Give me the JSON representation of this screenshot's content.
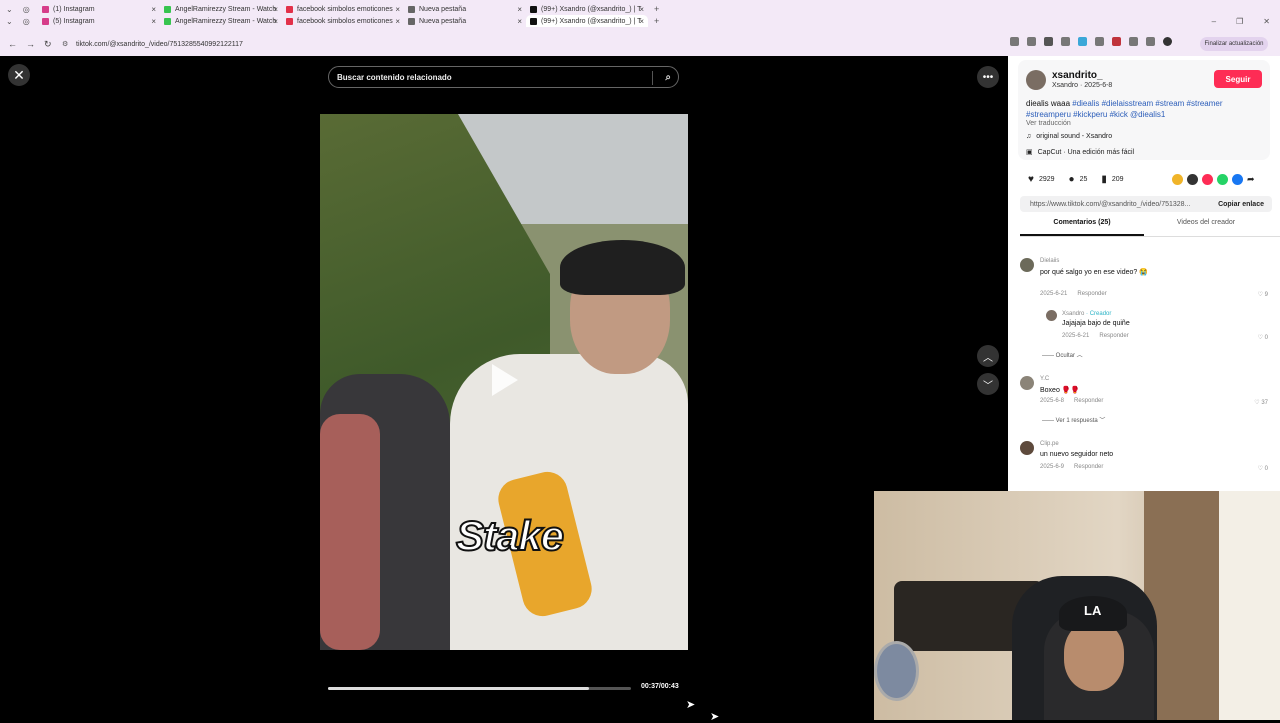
{
  "browser": {
    "tabs_row1": [
      {
        "label": "(1) Instagram",
        "color": "#d63c8a"
      },
      {
        "label": "AngelRamirezzy Stream - Watch",
        "color": "#37c44f"
      },
      {
        "label": "facebook simbolos emoticones",
        "color": "#e2314a"
      },
      {
        "label": "Nueva pestaña",
        "color": "#666666"
      },
      {
        "label": "(99+) Xsandro (@xsandrito_) | T",
        "color": "#111111"
      }
    ],
    "tabs_row2": [
      {
        "label": "(5) Instagram",
        "color": "#d63c8a"
      },
      {
        "label": "AngelRamirezzy Stream - Watch",
        "color": "#37c44f"
      },
      {
        "label": "facebook simbolos emoticones",
        "color": "#e2314a"
      },
      {
        "label": "Nueva pestaña",
        "color": "#666666"
      },
      {
        "label": "(99+) Xsandro (@xsandrito_) | T",
        "color": "#111111"
      }
    ],
    "url": "tiktok.com/@xsandrito_/video/7513285540992122117",
    "update_button": "Finalizar actualización"
  },
  "player": {
    "search_placeholder": "Buscar contenido relacionado",
    "overlay_text": "Stake",
    "time": "00:37/00:43",
    "progress_fraction": 0.86
  },
  "post": {
    "username": "xsandrito_",
    "subtitle": "Xsandro · 2025-6-8",
    "follow_label": "Seguir",
    "desc_text": "diealis waaa ",
    "desc_tags": "#diealis #dielaisstream #stream #streamer #streamperu #kickperu #kick @diealis1",
    "translate": "Ver traducción",
    "sound": "original sound - Xsandro",
    "capcut": "CapCut · Una edición más fácil",
    "likes": "2929",
    "comments": "25",
    "saves": "209",
    "link": "https://www.tiktok.com/@xsandrito_/video/751328...",
    "copy_label": "Copiar enlace",
    "tab_comments": "Comentarios (25)",
    "tab_creator": "Videos del creador"
  },
  "comments": [
    {
      "name": "Dielaiis",
      "text": "por qué salgo yo en ese video? 😭",
      "date": "2025-6-21",
      "reply": "Responder",
      "likes": "9"
    },
    {
      "name": "Xsandro",
      "creator": "· Creador",
      "text": "Jajajaja bajo de quiñe",
      "date": "2025-6-21",
      "reply": "Responder",
      "likes": "0",
      "hide": "Ocultar"
    },
    {
      "name": "Y.C",
      "text": "Boxeo 🥊🥊",
      "date": "2025-6-8",
      "reply": "Responder",
      "likes": "37",
      "more": "Ver 1 respuesta"
    },
    {
      "name": "Clip.pe",
      "text": "un nuevo seguidor neto",
      "date": "2025-6-9",
      "reply": "Responder",
      "likes": "0"
    }
  ],
  "colors": {
    "accent": "#fe2c55",
    "link": "#2b5db9"
  }
}
